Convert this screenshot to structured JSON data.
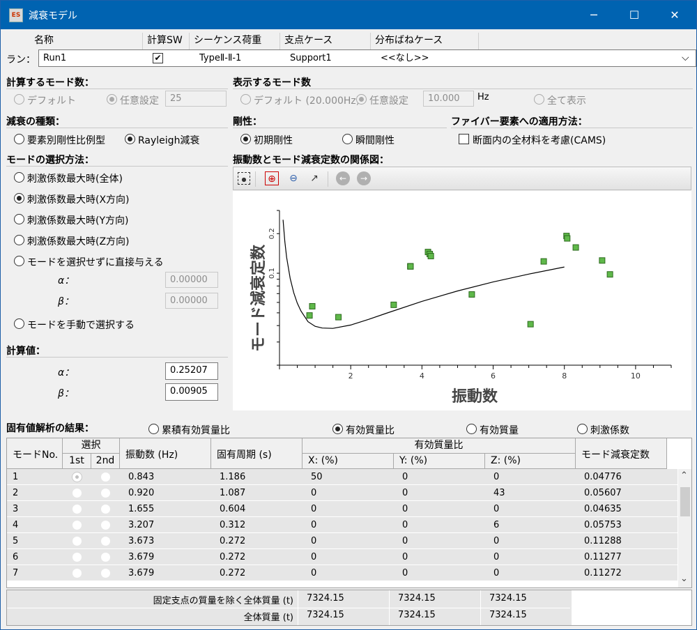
{
  "window": {
    "title": "減衰モデル",
    "icon_text": "ES",
    "buttons": {
      "minimize": "─",
      "maximize": "☐",
      "close": "✕"
    }
  },
  "run": {
    "label": "ラン：",
    "headers": [
      "名称",
      "計算SW",
      "シーケンス荷重",
      "支点ケース",
      "分布ばねケース"
    ],
    "row": {
      "name": "Run1",
      "calc_sw": "✔",
      "sequence": "TypeⅡ-Ⅱ-1",
      "support": "Support1",
      "spring": "<<なし>>"
    },
    "dropdown": "⌵"
  },
  "calc_modes": {
    "title": "計算するモード数：",
    "default": "デフォルト",
    "custom": "任意設定",
    "value": "25"
  },
  "display_modes": {
    "title": "表示するモード数",
    "default": "デフォルト (20.000Hz)",
    "custom": "任意設定",
    "value": "10.000",
    "unit": "Hz",
    "all": "全て表示"
  },
  "damping_type": {
    "title": "減衰の種類：",
    "opt1": "要素別剛性比例型",
    "opt2": "Rayleigh減衰"
  },
  "stiffness": {
    "title": "剛性：",
    "opt1": "初期剛性",
    "opt2": "瞬間剛性"
  },
  "fiber": {
    "title": "ファイバー要素への適用方法：",
    "check": "断面内の全材料を考慮(CAMS)"
  },
  "mode_select": {
    "title": "モードの選択方法：",
    "options": [
      "刺激係数最大時(全体)",
      "刺激係数最大時(X方向)",
      "刺激係数最大時(Y方向)",
      "刺激係数最大時(Z方向)",
      "モードを選択せずに直接与える"
    ],
    "alpha_label": "α：",
    "alpha_value": "0.00000",
    "beta_label": "β：",
    "beta_value": "0.00000",
    "manual": "モードを手動で選択する"
  },
  "calc_values": {
    "title": "計算値：",
    "alpha_label": "α：",
    "alpha_value": "0.25207",
    "beta_label": "β：",
    "beta_value": "0.00905"
  },
  "chart_title": "振動数とモード減衰定数の関係図：",
  "toolbar_icons": [
    "select-icon",
    "zoom-box-icon",
    "zoom-out-icon",
    "arrow-icon",
    "back-icon",
    "forward-icon"
  ],
  "chart_data": {
    "type": "scatter",
    "xlabel": "振動数",
    "ylabel": "モード減衰定数",
    "xlim": [
      0,
      11
    ],
    "ylim": [
      0.02,
      0.3
    ],
    "y_scale": "log",
    "x_ticks": [
      "2",
      "4",
      "6",
      "8",
      "10"
    ],
    "y_ticks": [
      "0.1",
      "0.2"
    ],
    "series": [
      {
        "type": "scatter",
        "color": "#5fb84a",
        "x": [
          0.843,
          0.92,
          1.655,
          3.207,
          3.673,
          3.679,
          3.679,
          4.17,
          4.22,
          4.25,
          5.4,
          7.05,
          7.42,
          8.06,
          8.08,
          8.32,
          9.06,
          9.28
        ],
        "y": [
          0.04776,
          0.05607,
          0.04635,
          0.05753,
          0.11288,
          0.11277,
          0.11272,
          0.145,
          0.14,
          0.135,
          0.069,
          0.041,
          0.123,
          0.192,
          0.184,
          0.157,
          0.125,
          0.098
        ]
      },
      {
        "type": "line",
        "x": [
          0.1,
          0.15,
          0.2,
          0.3,
          0.4,
          0.5,
          0.6,
          0.8,
          1.0,
          1.2,
          1.5,
          2,
          2.5,
          3,
          4,
          5,
          6,
          7,
          8
        ],
        "y": [
          0.255,
          0.1733,
          0.1323,
          0.0914,
          0.0712,
          0.0593,
          0.0517,
          0.0428,
          0.0395,
          0.0383,
          0.0381,
          0.0404,
          0.0446,
          0.0496,
          0.0611,
          0.0733,
          0.0858,
          0.0985,
          0.1115
        ]
      }
    ]
  },
  "results": {
    "title": "固有値解析の結果：",
    "options": [
      "累積有効質量比",
      "有効質量比",
      "有効質量",
      "刺激係数"
    ]
  },
  "table": {
    "headers": {
      "mode": "モードNo.",
      "select": "選択",
      "first": "1st",
      "second": "2nd",
      "freq": "振動数 (Hz)",
      "period": "固有周期 (s)",
      "ratio": "有効質量比",
      "x": "X: (%)",
      "y": "Y: (%)",
      "z": "Z: (%)",
      "damping": "モード減衰定数"
    },
    "rows": [
      {
        "no": "1",
        "freq": "0.843",
        "period": "1.186",
        "x": "50",
        "y": "0",
        "z": "0",
        "damp": "0.04776"
      },
      {
        "no": "2",
        "freq": "0.920",
        "period": "1.087",
        "x": "0",
        "y": "0",
        "z": "43",
        "damp": "0.05607"
      },
      {
        "no": "3",
        "freq": "1.655",
        "period": "0.604",
        "x": "0",
        "y": "0",
        "z": "0",
        "damp": "0.04635"
      },
      {
        "no": "4",
        "freq": "3.207",
        "period": "0.312",
        "x": "0",
        "y": "0",
        "z": "6",
        "damp": "0.05753"
      },
      {
        "no": "5",
        "freq": "3.673",
        "period": "0.272",
        "x": "0",
        "y": "0",
        "z": "0",
        "damp": "0.11288"
      },
      {
        "no": "6",
        "freq": "3.679",
        "period": "0.272",
        "x": "0",
        "y": "0",
        "z": "0",
        "damp": "0.11277"
      },
      {
        "no": "7",
        "freq": "3.679",
        "period": "0.272",
        "x": "0",
        "y": "0",
        "z": "0",
        "damp": "0.11272"
      }
    ],
    "scroll_up": "⌃",
    "scroll_down": "⌄"
  },
  "totals": {
    "row1_label": "固定支点の質量を除く全体質量 (t)",
    "row1": [
      "7324.15",
      "7324.15",
      "7324.15"
    ],
    "row2_label": "全体質量 (t)",
    "row2": [
      "7324.15",
      "7324.15",
      "7324.15"
    ]
  }
}
